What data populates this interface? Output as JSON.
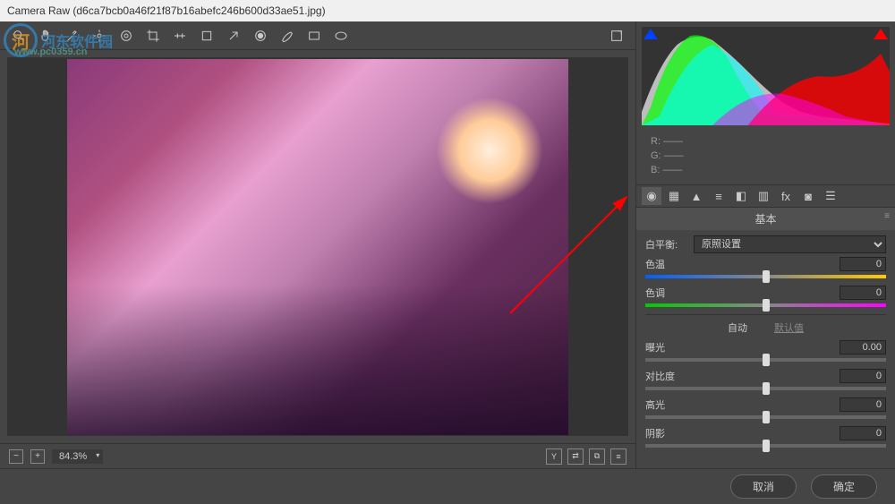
{
  "window": {
    "title": "Camera Raw  (d6ca7bcb0a46f21f87b16abefc246b600d33ae51.jpg)"
  },
  "watermark": {
    "text": "河东软件园",
    "url": "www.pc0359.cn"
  },
  "zoom": {
    "level": "84.3%"
  },
  "rgb": {
    "r_label": "R:",
    "g_label": "G:",
    "b_label": "B:",
    "r": "——",
    "g": "——",
    "b": "——"
  },
  "panel": {
    "title": "基本"
  },
  "wb": {
    "label": "白平衡:",
    "selected": "原照设置"
  },
  "sliders": {
    "temp": {
      "label": "色温",
      "value": "0"
    },
    "tint": {
      "label": "色调",
      "value": "0"
    },
    "auto": "自动",
    "default": "默认值",
    "exposure": {
      "label": "曝光",
      "value": "0.00"
    },
    "contrast": {
      "label": "对比度",
      "value": "0"
    },
    "highlights": {
      "label": "高光",
      "value": "0"
    },
    "shadows": {
      "label": "阴影",
      "value": "0"
    }
  },
  "footer": {
    "cancel": "取消",
    "ok": "确定"
  }
}
